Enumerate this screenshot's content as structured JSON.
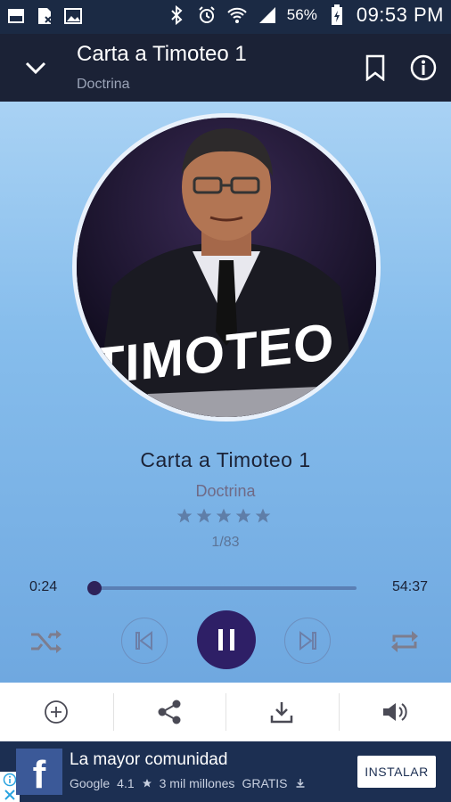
{
  "status_bar": {
    "battery_percent": "56%",
    "time": "09:53 PM",
    "icons": [
      "notification-icon",
      "doc-icon",
      "image-icon",
      "bluetooth-icon",
      "alarm-icon",
      "wifi-icon",
      "signal-icon",
      "battery-icon"
    ]
  },
  "app_bar": {
    "title": "Carta a Timoteo 1",
    "subtitle": "Doctrina",
    "icons": [
      "chevron-down-icon",
      "bookmark-icon",
      "info-icon"
    ]
  },
  "cover": {
    "overlay_text": "TIMOTEO"
  },
  "track": {
    "title": "Carta a Timoteo 1",
    "category": "Doctrina",
    "rating_stars": 5,
    "rating_value": 0,
    "position": "1/83"
  },
  "progress": {
    "current_time": "0:24",
    "total_time": "54:37",
    "fraction": 0.007
  },
  "controls": {
    "icons": [
      "shuffle-icon",
      "previous-icon",
      "pause-icon",
      "next-icon",
      "repeat-icon"
    ],
    "accent_color": "#2e1f66"
  },
  "actions": {
    "icons": [
      "add-icon",
      "share-icon",
      "download-icon",
      "volume-icon"
    ]
  },
  "ad": {
    "headline": "La mayor comunidad",
    "sub_store": "Google",
    "sub_rating": "4.1",
    "sub_installs": "3 mil millones",
    "sub_price": "GRATIS",
    "button_label": "INSTALAR",
    "brand_color": "#3b5998"
  }
}
